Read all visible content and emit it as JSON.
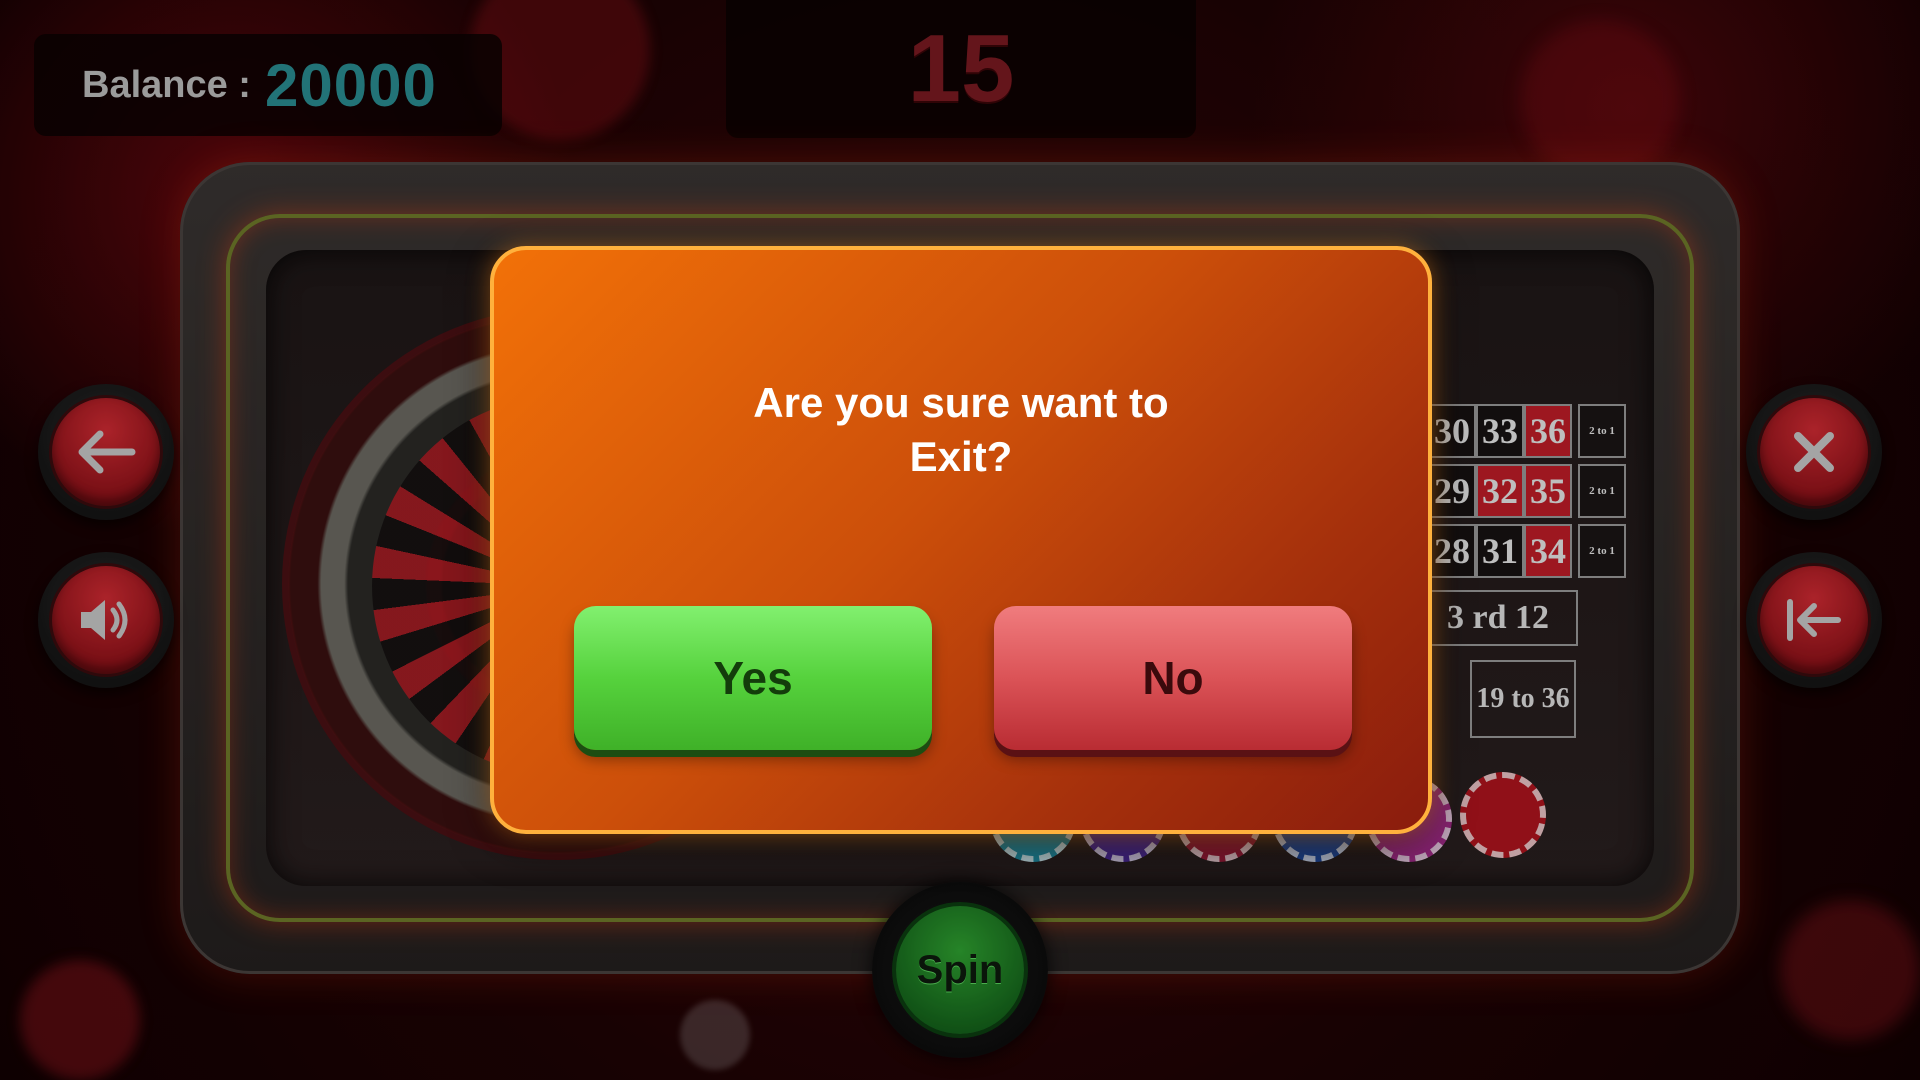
{
  "hud": {
    "balance_label": "Balance :",
    "balance_value": "20000",
    "last_result": "15"
  },
  "board": {
    "rows": [
      [
        {
          "n": "30",
          "color": "black"
        },
        {
          "n": "33",
          "color": "black"
        },
        {
          "n": "36",
          "color": "red"
        }
      ],
      [
        {
          "n": "29",
          "color": "black"
        },
        {
          "n": "32",
          "color": "red"
        },
        {
          "n": "35",
          "color": "red"
        }
      ],
      [
        {
          "n": "28",
          "color": "black"
        },
        {
          "n": "31",
          "color": "black"
        },
        {
          "n": "34",
          "color": "red"
        }
      ]
    ],
    "column_bet": "2 to 1",
    "dozen_label": "3 rd 12",
    "high_label": "19 to 36"
  },
  "controls": {
    "spin_label": "Spin",
    "back_icon": "arrow-left-icon",
    "sound_icon": "speaker-icon",
    "close_icon": "close-icon",
    "exit_icon": "exit-icon"
  },
  "dialog": {
    "message": "Are you sure want to Exit?",
    "yes_label": "Yes",
    "no_label": "No"
  },
  "colors": {
    "balance_value": "#2a8d92",
    "dialog_orange": "#f27108",
    "yes_green": "#56d23d",
    "no_red": "#db5357"
  }
}
